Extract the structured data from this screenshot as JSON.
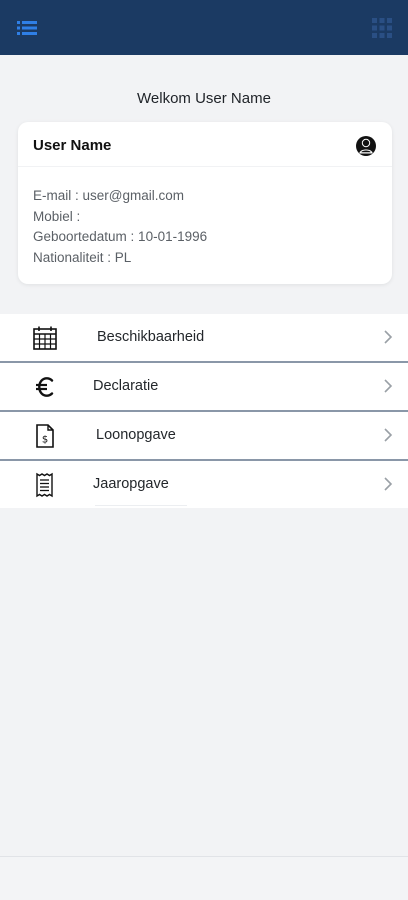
{
  "header": {
    "menu_icon": "list-icon",
    "grid_icon": "grid-icon",
    "colors": {
      "bar": "#1b3a63",
      "menu_icon": "#2f7fe6"
    }
  },
  "welcome": {
    "text": "Welkom User Name"
  },
  "profile": {
    "name": "User Name",
    "avatar_icon": "user-circle-icon",
    "email_line": "E-mail : user@gmail.com",
    "mobile_line": "Mobiel :",
    "dob_line": "Geboortedatum : 10-01-1996",
    "nationality_line": "Nationaliteit : PL"
  },
  "menu": [
    {
      "label": "Beschikbaarheid",
      "icon": "calendar-icon"
    },
    {
      "label": "Declaratie",
      "icon": "euro-icon"
    },
    {
      "label": "Loonopgave",
      "icon": "document-dollar-icon"
    },
    {
      "label": "Jaaropgave",
      "icon": "receipt-icon"
    }
  ]
}
